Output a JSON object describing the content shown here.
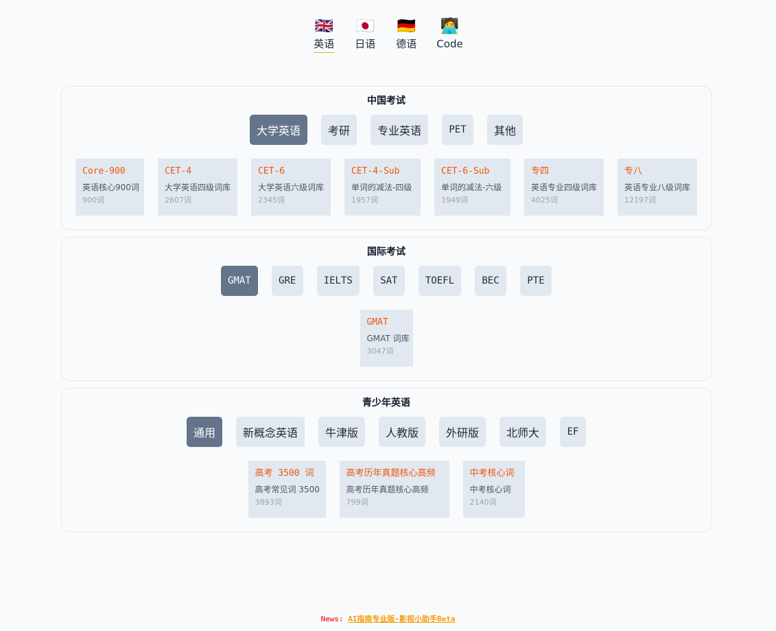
{
  "lang_nav": [
    {
      "flag": "🇬🇧",
      "label": "英语",
      "active": true
    },
    {
      "flag": "🇯🇵",
      "label": "日语",
      "active": false
    },
    {
      "flag": "🇩🇪",
      "label": "德语",
      "active": false
    },
    {
      "flag": "🧑‍💻",
      "label": "Code",
      "active": false
    }
  ],
  "sections": [
    {
      "title": "中国考试",
      "tabs": [
        {
          "label": "大学英语",
          "active": true
        },
        {
          "label": "考研",
          "active": false
        },
        {
          "label": "专业英语",
          "active": false
        },
        {
          "label": "PET",
          "active": false
        },
        {
          "label": "其他",
          "active": false
        }
      ],
      "cards": [
        {
          "name": "Core-900",
          "desc": "英语核心900词",
          "count": "900词"
        },
        {
          "name": "CET-4",
          "desc": "大学英语四级词库",
          "count": "2607词"
        },
        {
          "name": "CET-6",
          "desc": "大学英语六级词库",
          "count": "2345词"
        },
        {
          "name": "CET-4-Sub",
          "desc": "单词的减法-四级",
          "count": "1957词"
        },
        {
          "name": "CET-6-Sub",
          "desc": "单词的减法-六级",
          "count": "1949词"
        },
        {
          "name": "专四",
          "desc": "英语专业四级词库",
          "count": "4025词"
        },
        {
          "name": "专八",
          "desc": "英语专业八级词库",
          "count": "12197词"
        }
      ]
    },
    {
      "title": "国际考试",
      "tabs": [
        {
          "label": "GMAT",
          "active": true
        },
        {
          "label": "GRE",
          "active": false
        },
        {
          "label": "IELTS",
          "active": false
        },
        {
          "label": "SAT",
          "active": false
        },
        {
          "label": "TOEFL",
          "active": false
        },
        {
          "label": "BEC",
          "active": false
        },
        {
          "label": "PTE",
          "active": false
        }
      ],
      "cards": [
        {
          "name": "GMAT",
          "desc": "GMAT 词库",
          "count": "3047词"
        }
      ]
    },
    {
      "title": "青少年英语",
      "tabs": [
        {
          "label": "通用",
          "active": true
        },
        {
          "label": "新概念英语",
          "active": false
        },
        {
          "label": "牛津版",
          "active": false
        },
        {
          "label": "人教版",
          "active": false
        },
        {
          "label": "外研版",
          "active": false
        },
        {
          "label": "北师大",
          "active": false
        },
        {
          "label": "EF",
          "active": false
        }
      ],
      "cards": [
        {
          "name": "高考 3500 词",
          "desc": "高考常见词 3500",
          "count": "3893词"
        },
        {
          "name": "高考历年真题核心高频",
          "desc": "高考历年真题核心高频",
          "count": "799词"
        },
        {
          "name": "中考核心词",
          "desc": "中考核心词",
          "count": "2140词"
        }
      ]
    }
  ],
  "news": {
    "prefix": "News:",
    "link": "AI指南专业版-影视小助手Beta"
  },
  "colors": {
    "active_tab": "#64748b",
    "tab": "#e2e8f0",
    "card_name": "#ea580c",
    "news_prefix": "#ef4444",
    "news_link": "#f59e0b",
    "lang_underline": "#eab308"
  }
}
